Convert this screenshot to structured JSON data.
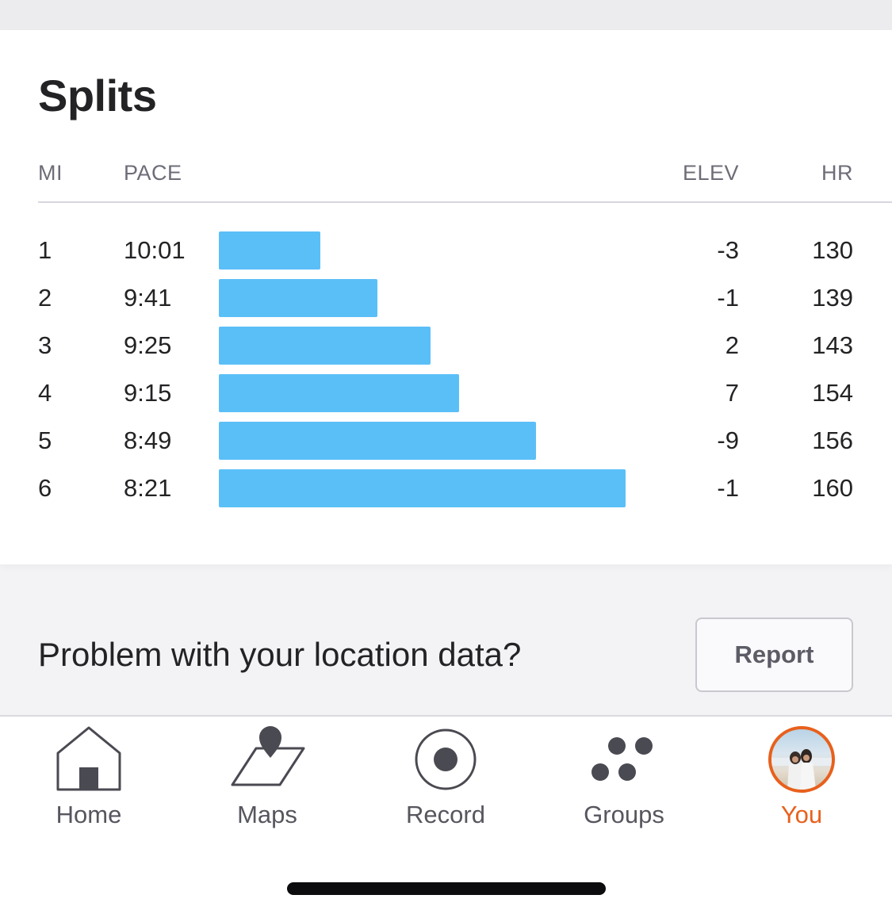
{
  "splits": {
    "title": "Splits",
    "headers": {
      "mi": "MI",
      "pace": "PACE",
      "elev": "ELEV",
      "hr": "HR"
    },
    "bar_color": "#5bbff7",
    "rows": [
      {
        "mi": "1",
        "pace": "10:01",
        "elev": "-3",
        "hr": "130",
        "bar_fraction": 0.25
      },
      {
        "mi": "2",
        "pace": "9:41",
        "elev": "-1",
        "hr": "139",
        "bar_fraction": 0.39
      },
      {
        "mi": "3",
        "pace": "9:25",
        "elev": "2",
        "hr": "143",
        "bar_fraction": 0.52
      },
      {
        "mi": "4",
        "pace": "9:15",
        "elev": "7",
        "hr": "154",
        "bar_fraction": 0.59
      },
      {
        "mi": "5",
        "pace": "8:49",
        "elev": "-9",
        "hr": "156",
        "bar_fraction": 0.78
      },
      {
        "mi": "6",
        "pace": "8:21",
        "elev": "-1",
        "hr": "160",
        "bar_fraction": 1.0
      }
    ]
  },
  "location_problem": {
    "text": "Problem with your location data?",
    "button_label": "Report"
  },
  "tabbar": {
    "active_color": "#e8601c",
    "tabs": [
      {
        "label": "Home",
        "icon": "home-icon"
      },
      {
        "label": "Maps",
        "icon": "map-pin-icon"
      },
      {
        "label": "Record",
        "icon": "record-icon"
      },
      {
        "label": "Groups",
        "icon": "groups-icon"
      },
      {
        "label": "You",
        "icon": "avatar",
        "active": true
      }
    ]
  }
}
